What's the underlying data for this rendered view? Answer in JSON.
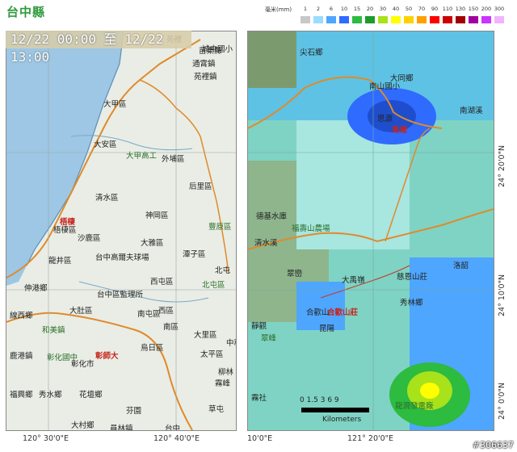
{
  "header": {
    "title": "台中縣",
    "legend_unit": "毫米(mm)",
    "legend": [
      {
        "label": "1",
        "color": "#c8c8c8"
      },
      {
        "label": "2",
        "color": "#9bdcff"
      },
      {
        "label": "6",
        "color": "#4fa6ff"
      },
      {
        "label": "10",
        "color": "#2f6bff"
      },
      {
        "label": "15",
        "color": "#2dbb40"
      },
      {
        "label": "20",
        "color": "#1f9a2c"
      },
      {
        "label": "30",
        "color": "#a8e21a"
      },
      {
        "label": "40",
        "color": "#ffff00"
      },
      {
        "label": "50",
        "color": "#ffd200"
      },
      {
        "label": "70",
        "color": "#ffa000"
      },
      {
        "label": "90",
        "color": "#ff0000"
      },
      {
        "label": "110",
        "color": "#cc0000"
      },
      {
        "label": "130",
        "color": "#a00000"
      },
      {
        "label": "150",
        "color": "#a000a0"
      },
      {
        "label": "200",
        "color": "#cc33ff"
      },
      {
        "label": "300",
        "color": "#f0b4ff"
      }
    ]
  },
  "time_range": "12/22 00:00 至 12/22 13:00",
  "left_map": {
    "places": [
      {
        "text": "大甲區"
      },
      {
        "text": "大安區"
      },
      {
        "text": "大甲高工"
      },
      {
        "text": "外埔區"
      },
      {
        "text": "后里區"
      },
      {
        "text": "清水區"
      },
      {
        "text": "梧棲"
      },
      {
        "text": "梧棲區"
      },
      {
        "text": "沙鹿區"
      },
      {
        "text": "神岡區"
      },
      {
        "text": "大雅區"
      },
      {
        "text": "潭子區"
      },
      {
        "text": "豐原區"
      },
      {
        "text": "龍井區"
      },
      {
        "text": "台中高爾夫球場"
      },
      {
        "text": "西屯區"
      },
      {
        "text": "北屯區"
      },
      {
        "text": "伸港鄉"
      },
      {
        "text": "台中區監理所"
      },
      {
        "text": "大肚區"
      },
      {
        "text": "南屯區"
      },
      {
        "text": "西區"
      },
      {
        "text": "南區"
      },
      {
        "text": "烏日區"
      },
      {
        "text": "線西鄉"
      },
      {
        "text": "和美鎮"
      },
      {
        "text": "鹿港鎮"
      },
      {
        "text": "彰化國中"
      },
      {
        "text": "彰師大"
      },
      {
        "text": "彰化市"
      },
      {
        "text": "福興鄉"
      },
      {
        "text": "秀水鄉"
      },
      {
        "text": "花壇鄉"
      },
      {
        "text": "芬園"
      },
      {
        "text": "大村鄉"
      },
      {
        "text": "員林鎮"
      },
      {
        "text": "苑裡"
      },
      {
        "text": "苗栗縣"
      },
      {
        "text": "通霄鎮"
      },
      {
        "text": "苑裡鎮"
      },
      {
        "text": "城中國小"
      },
      {
        "text": "北屯"
      },
      {
        "text": "大里區"
      },
      {
        "text": "太平區"
      },
      {
        "text": "中和"
      },
      {
        "text": "霧峰"
      },
      {
        "text": "柳林"
      },
      {
        "text": "草屯"
      },
      {
        "text": "台中"
      }
    ],
    "coords_x": [
      "120° 30'0\"E",
      "120° 40'0\"E"
    ]
  },
  "right_map": {
    "places": [
      {
        "text": "尖石鄉"
      },
      {
        "text": "大同鄉"
      },
      {
        "text": "南山國小"
      },
      {
        "text": "思源"
      },
      {
        "text": "南湖溪"
      },
      {
        "text": "馬達"
      },
      {
        "text": "福壽山農場"
      },
      {
        "text": "慈恩山莊"
      },
      {
        "text": "翠巒"
      },
      {
        "text": "大禹嶺"
      },
      {
        "text": "合歡山"
      },
      {
        "text": "合歡山莊"
      },
      {
        "text": "昆陽"
      },
      {
        "text": "秀林鄉"
      },
      {
        "text": "清水溪"
      },
      {
        "text": "翠峰"
      },
      {
        "text": "靜觀"
      },
      {
        "text": "龍澗發電廠"
      },
      {
        "text": "洛韶"
      },
      {
        "text": "霧社"
      },
      {
        "text": "德基水庫"
      }
    ],
    "coords_x": [
      "10'0\"E",
      "121° 20'0\"E"
    ],
    "coords_y": [
      "24° 20'0\"N",
      "24° 10'0\"N",
      "24° 0'0\"N"
    ],
    "scale_numbers": "0 1.5 3     6     9",
    "scale_unit": "Kilometers"
  },
  "watermark": "#306637"
}
